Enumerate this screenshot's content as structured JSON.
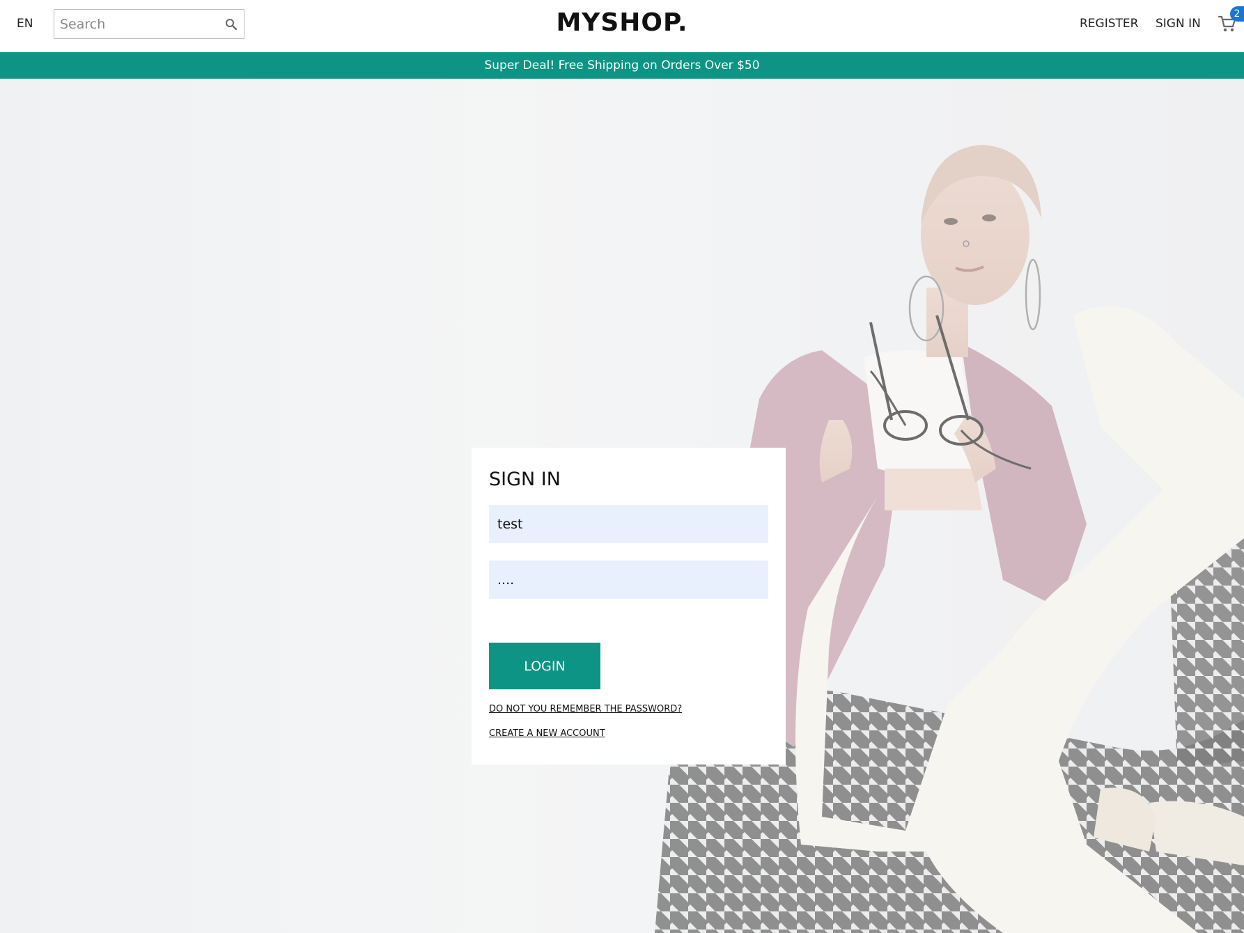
{
  "header": {
    "language": "EN",
    "search_placeholder": "Search",
    "logo": "MYSHOP.",
    "register_label": "REGISTER",
    "signin_label": "SIGN IN",
    "cart_count": "2"
  },
  "promo": {
    "text": "Super Deal! Free Shipping on Orders Over $50"
  },
  "signin_form": {
    "title": "SIGN IN",
    "username_value": "test",
    "password_value": "....",
    "login_label": "LOGIN",
    "forgot_link": "DO NOT YOU REMEMBER THE PASSWORD?",
    "create_link": "CREATE A NEW ACCOUNT"
  },
  "colors": {
    "accent": "#0d9484",
    "badge": "#1976d2",
    "input_bg": "#e8f0fe"
  },
  "icons": {
    "search": "search-icon",
    "cart": "cart-icon"
  }
}
